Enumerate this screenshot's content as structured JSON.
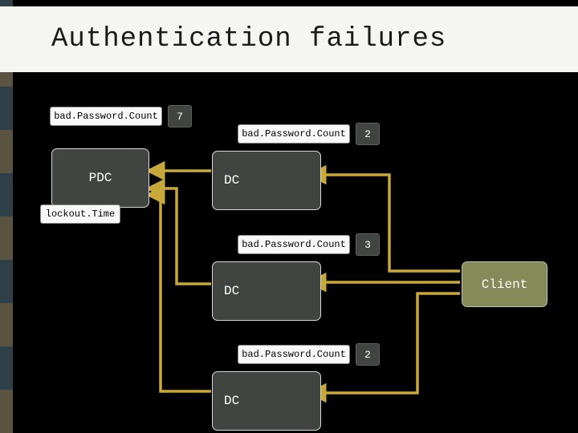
{
  "title": "Authentication failures",
  "pdc": {
    "label": "PDC",
    "bad_password_count_label": "bad.Password.Count",
    "bad_password_count_value": "7",
    "lockout_label": "lockout.Time"
  },
  "dcs": [
    {
      "label": "DC",
      "bad_password_count_label": "bad.Password.Count",
      "bad_password_count_value": "2"
    },
    {
      "label": "DC",
      "bad_password_count_label": "bad.Password.Count",
      "bad_password_count_value": "3"
    },
    {
      "label": "DC",
      "bad_password_count_label": "bad.Password.Count",
      "bad_password_count_value": "2"
    }
  ],
  "client": {
    "label": "Client"
  },
  "colors": {
    "accent": "#c8a83b",
    "box_fill": "#404542",
    "olive": "#848a58"
  }
}
